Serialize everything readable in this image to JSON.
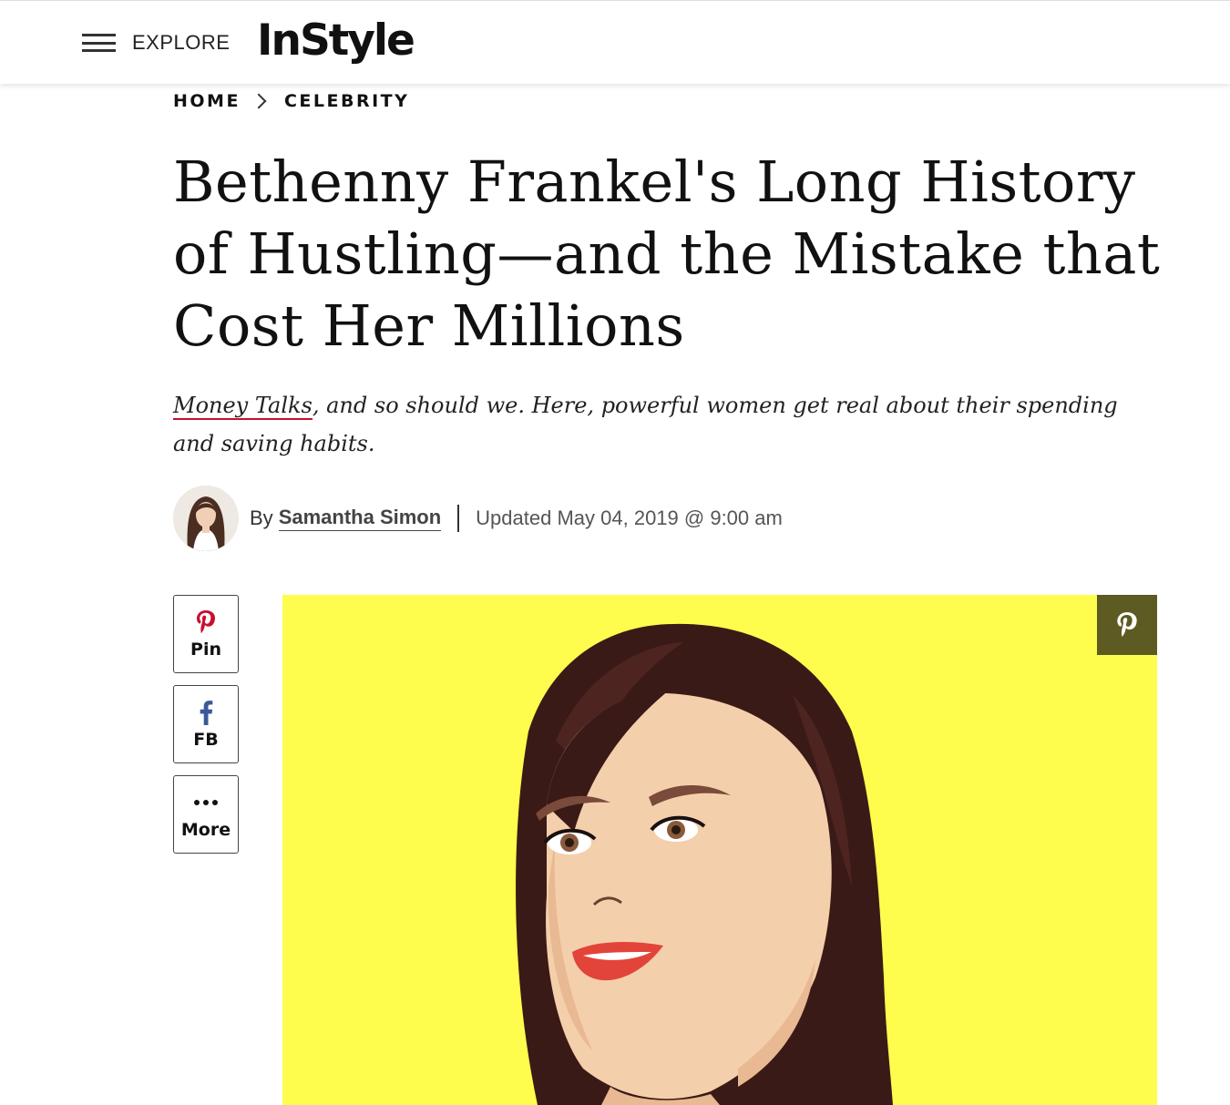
{
  "header": {
    "menu_label": "EXPLORE",
    "logo_text": "InStyle"
  },
  "breadcrumb": {
    "items": [
      "HOME",
      "CELEBRITY"
    ]
  },
  "article": {
    "headline": "Bethenny Frankel's Long History of Hustling—and the Mistake that Cost Her Millions",
    "dek_link": "Money Talks",
    "dek_rest": ", and so should we. Here, powerful women get real about their spending and saving habits.",
    "byline_prefix": "By",
    "author": "Samantha Simon",
    "updated": "Updated May 04, 2019 @ 9:00 am"
  },
  "share": {
    "pin_label": "Pin",
    "fb_label": "FB",
    "more_label": "More"
  },
  "colors": {
    "hero_background": "#fefd4e",
    "pinterest_red": "#c8102e",
    "facebook_blue": "#3b5998",
    "pin_overlay": "#5d5a22"
  },
  "icons": {
    "menu": "hamburger-icon",
    "breadcrumb_separator": "chevron-right-icon",
    "pin": "pinterest-icon",
    "fb": "facebook-icon",
    "more": "ellipsis-icon"
  }
}
